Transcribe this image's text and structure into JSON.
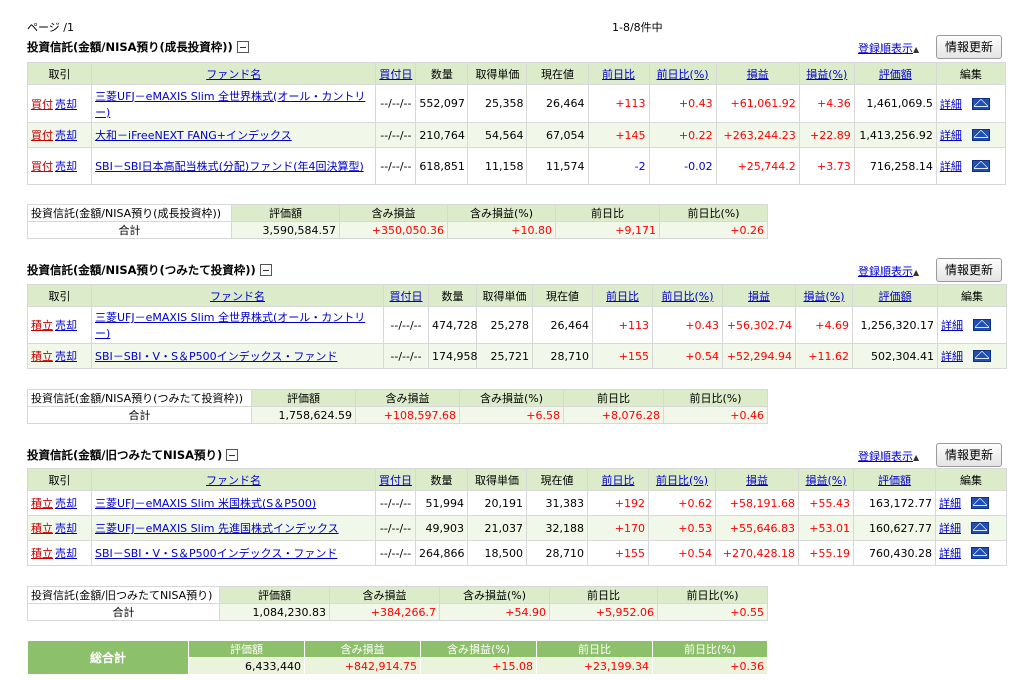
{
  "page": {
    "page_label": "ページ /1",
    "range_label": "1-8/8件中"
  },
  "common": {
    "sort_link": "登録順表示",
    "sort_arrow": "▲",
    "refresh_button": "情報更新",
    "headers": [
      "取引",
      "ファンド名",
      "買付日",
      "数量",
      "取得単価",
      "現在値",
      "前日比",
      "前日比(%)",
      "損益",
      "損益(%)",
      "評価額",
      "編集"
    ],
    "detail_label": "詳細",
    "summary_headers": [
      "評価額",
      "含み損益",
      "含み損益(%)",
      "前日比",
      "前日比(%)"
    ],
    "total_label": "合計"
  },
  "sections": [
    {
      "title": "投資信託(金額/NISA預り(成長投資枠))",
      "summary_title": "投資信託(金額/NISA預り(成長投資枠))",
      "rows": [
        {
          "buy": "買付",
          "sell": "売却",
          "fund": "三菱UFJ－eMAXIS Slim 全世界株式(オール・カントリー)",
          "date": "--/--/--",
          "qty": "552,097",
          "cost": "25,358",
          "price": "26,464",
          "chg": "+113",
          "chg_pct": "+0.43",
          "pl": "+61,061.92",
          "pl_pct": "+4.36",
          "value": "1,461,069.5"
        },
        {
          "buy": "買付",
          "sell": "売却",
          "fund": "大和－iFreeNEXT FANG+インデックス",
          "date": "--/--/--",
          "qty": "210,764",
          "cost": "54,564",
          "price": "67,054",
          "chg": "+145",
          "chg_pct": "+0.22",
          "pl": "+263,244.23",
          "pl_pct": "+22.89",
          "value": "1,413,256.92"
        },
        {
          "buy": "買付",
          "sell": "売却",
          "fund": "SBI－SBI日本高配当株式(分配)ファンド(年4回決算型)",
          "date": "--/--/--",
          "qty": "618,851",
          "cost": "11,158",
          "price": "11,574",
          "chg": "-2",
          "chg_pct": "-0.02",
          "pl": "+25,744.2",
          "pl_pct": "+3.73",
          "value": "716,258.14"
        }
      ],
      "summary": {
        "value": "3,590,584.57",
        "gain": "+350,050.36",
        "gain_pct": "+10.80",
        "chg": "+9,171",
        "chg_pct": "+0.26"
      }
    },
    {
      "title": "投資信託(金額/NISA預り(つみたて投資枠))",
      "summary_title": "投資信託(金額/NISA預り(つみたて投資枠))",
      "rows": [
        {
          "buy": "積立",
          "sell": "売却",
          "fund": "三菱UFJ－eMAXIS Slim 全世界株式(オール・カントリー)",
          "date": "--/--/--",
          "qty": "474,728",
          "cost": "25,278",
          "price": "26,464",
          "chg": "+113",
          "chg_pct": "+0.43",
          "pl": "+56,302.74",
          "pl_pct": "+4.69",
          "value": "1,256,320.17"
        },
        {
          "buy": "積立",
          "sell": "売却",
          "fund": "SBI－SBI・V・S＆P500インデックス・ファンド",
          "date": "--/--/--",
          "qty": "174,958",
          "cost": "25,721",
          "price": "28,710",
          "chg": "+155",
          "chg_pct": "+0.54",
          "pl": "+52,294.94",
          "pl_pct": "+11.62",
          "value": "502,304.41"
        }
      ],
      "summary": {
        "value": "1,758,624.59",
        "gain": "+108,597.68",
        "gain_pct": "+6.58",
        "chg": "+8,076.28",
        "chg_pct": "+0.46"
      }
    },
    {
      "title": "投資信託(金額/旧つみたてNISA預り)",
      "summary_title": "投資信託(金額/旧つみたてNISA預り)",
      "rows": [
        {
          "buy": "積立",
          "sell": "売却",
          "fund": "三菱UFJ－eMAXIS Slim 米国株式(S＆P500)",
          "date": "--/--/--",
          "qty": "51,994",
          "cost": "20,191",
          "price": "31,383",
          "chg": "+192",
          "chg_pct": "+0.62",
          "pl": "+58,191.68",
          "pl_pct": "+55.43",
          "value": "163,172.77"
        },
        {
          "buy": "積立",
          "sell": "売却",
          "fund": "三菱UFJ－eMAXIS Slim 先進国株式インデックス",
          "date": "--/--/--",
          "qty": "49,903",
          "cost": "21,037",
          "price": "32,188",
          "chg": "+170",
          "chg_pct": "+0.53",
          "pl": "+55,646.83",
          "pl_pct": "+53.01",
          "value": "160,627.77"
        },
        {
          "buy": "積立",
          "sell": "売却",
          "fund": "SBI－SBI・V・S＆P500インデックス・ファンド",
          "date": "--/--/--",
          "qty": "264,866",
          "cost": "18,500",
          "price": "28,710",
          "chg": "+155",
          "chg_pct": "+0.54",
          "pl": "+270,428.18",
          "pl_pct": "+55.19",
          "value": "760,430.28"
        }
      ],
      "summary": {
        "value": "1,084,230.83",
        "gain": "+384,266.7",
        "gain_pct": "+54.90",
        "chg": "+5,952.06",
        "chg_pct": "+0.55"
      }
    }
  ],
  "grand_total": {
    "label": "総合計",
    "value": "6,433,440",
    "gain": "+842,914.75",
    "gain_pct": "+15.08",
    "chg": "+23,199.34",
    "chg_pct": "+0.36"
  }
}
